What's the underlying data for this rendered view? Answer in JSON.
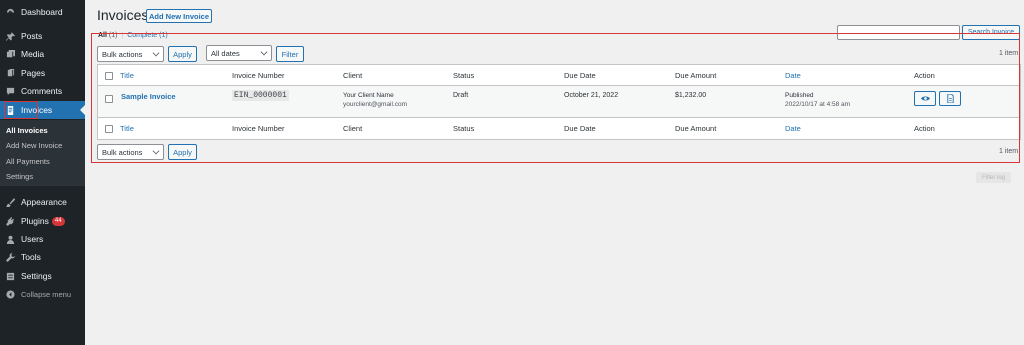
{
  "sidebar": {
    "items": [
      {
        "label": "Dashboard",
        "icon": "dashboard-icon"
      },
      {
        "label": "Posts",
        "icon": "pin-icon"
      },
      {
        "label": "Media",
        "icon": "media-icon"
      },
      {
        "label": "Pages",
        "icon": "pages-icon"
      },
      {
        "label": "Comments",
        "icon": "comments-icon"
      },
      {
        "label": "Invoices",
        "icon": "invoice-icon"
      },
      {
        "label": "Appearance",
        "icon": "brush-icon"
      },
      {
        "label": "Plugins",
        "icon": "plugin-icon",
        "badge": "44"
      },
      {
        "label": "Users",
        "icon": "users-icon"
      },
      {
        "label": "Tools",
        "icon": "wrench-icon"
      },
      {
        "label": "Settings",
        "icon": "settings-icon"
      }
    ],
    "submenu": [
      "All Invoices",
      "Add New Invoice",
      "All Payments",
      "Settings"
    ],
    "collapse_label": "Collapse menu"
  },
  "page": {
    "title": "Invoices",
    "add_new_label": "Add New Invoice",
    "search_button": "Search Invoice",
    "views": {
      "all_label": "All",
      "all_count": "(1)",
      "separator": "|",
      "complete_label": "Complete",
      "complete_count": "(1)"
    },
    "bulk_actions": "Bulk actions",
    "apply": "Apply",
    "all_dates": "All dates",
    "filter": "Filter",
    "items_count": "1 item",
    "faded_button": "Filter log"
  },
  "table": {
    "columns": [
      "Title",
      "Invoice Number",
      "Client",
      "Status",
      "Due Date",
      "Due Amount",
      "Date",
      "Action"
    ],
    "rows": [
      {
        "title": "Sample Invoice",
        "invoice_number": "EIN_0000001",
        "client_name": "Your Client Name",
        "client_email": "yourclient@gmail.com",
        "status": "Draft",
        "due_date": "October 21, 2022",
        "due_amount": "$1,232.00",
        "date_status": "Published",
        "date_value": "2022/10/17 at 4:58 am"
      }
    ]
  },
  "colors": {
    "accent": "#2271b1",
    "sidebar_bg": "#1d2327",
    "highlight": "#d63638"
  }
}
